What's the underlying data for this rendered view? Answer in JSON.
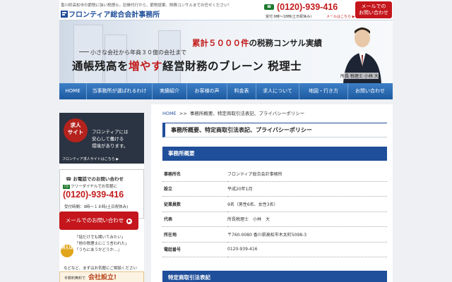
{
  "header": {
    "tagline": "香川県高松市の節税に強い税理士。記帳代行から、節税提案、財務コンサルまでお任せください！",
    "logo_text": "フロンティア総合会計事務所",
    "phone": "(0120)-939-416",
    "hours": "受付:9時〜18時(土日祝休み)",
    "mail_link": "メールはこちら ▶",
    "mail_button": "メールでの\nお問い合わせ"
  },
  "hero": {
    "subtitle_red": "累計５０００件",
    "subtitle_rest": "の税務コンサル実績",
    "small_text": "小さな会社から年商３０億の会社まで",
    "main_pre": "通帳残高を",
    "main_red": "増やす",
    "main_post": "経営財務のブレーン 税理士",
    "caption": "所長 税理士 小林 大"
  },
  "nav": {
    "items": [
      "HOME",
      "当事務所が選ばれるわけ",
      "実績紹介",
      "お客様の声",
      "料金表",
      "求人について",
      "地図・行き方",
      "お問い合わせ"
    ]
  },
  "sidebar": {
    "recruit_title": "求人\nサイト",
    "recruit_sub": "recruit",
    "recruit_text": "フロンティアには\n安心して働ける\n環境があります。",
    "recruit_link": "フロンティア求人サイトはこちら ▶",
    "contact_heading": "お電話でのお問い合わせ",
    "free_dial_label": "フリーダイヤルでお気軽に",
    "free_dial_icon": "FD",
    "phone": "(0120)-939-416",
    "hours": "受付時間：9時〜１８時(土日祝休み)",
    "mail_button": "メールでのお問い合わせ",
    "example_badge": "例えば",
    "examples": [
      "「話だけでも聞いてみたい」",
      "「他の税理士にこう言われた」",
      "「うちにあうかどうか…」"
    ],
    "example_footer": "などなど、まずはお気軽にご相談ください",
    "setup_small": "手数料無料で",
    "setup_big": "会社設立!"
  },
  "main": {
    "breadcrumb_home": "HOME",
    "breadcrumb_sep": ">>",
    "breadcrumb_current": "事務所概要、特定商取引法表記、プライバシーポリシー",
    "page_title": "事務所概要、特定商取引法表記、プライバシーポリシー",
    "section1_title": "事務所概要",
    "rows": [
      {
        "label": "事務所名",
        "value": "フロンティア総合会計事務所"
      },
      {
        "label": "設立",
        "value": "平成20年1月"
      },
      {
        "label": "従業員数",
        "value": "9名（男性6名、女性3名）"
      },
      {
        "label": "代表",
        "value": "所長税理士　小林　大"
      },
      {
        "label": "所在地",
        "value": "〒760-0080 香川県高松市木太町5098-3"
      },
      {
        "label": "電話番号",
        "value": "0120-939-416"
      }
    ],
    "section2_title": "特定商取引法表記"
  },
  "colors": {
    "brand_blue": "#1f4e9a",
    "accent_red": "#c4161c",
    "phone_green": "#1c7a2e"
  }
}
